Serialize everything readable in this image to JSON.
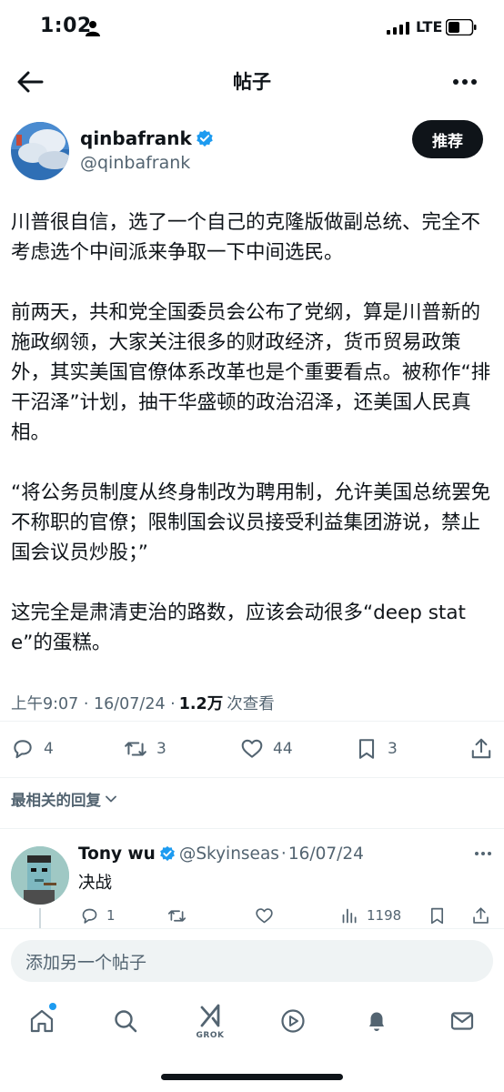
{
  "status_bar": {
    "time": "1:02",
    "network": "LTE"
  },
  "header": {
    "title": "帖子"
  },
  "post": {
    "author_name": "qinbafrank",
    "author_handle": "@qinbafrank",
    "follow_label": "推荐",
    "paragraphs": [
      "川普很自信，选了一个自己的克隆版做副总统、完全不考虑选个中间派来争取一下中间选民。",
      "前两天，共和党全国委员会公布了党纲，算是川普新的施政纲领，大家关注很多的财政经济，货币贸易政策外，其实美国官僚体系改革也是个重要看点。被称作“排干沼泽”计划，抽干华盛顿的政治沼泽，还美国人民真相。",
      "“将公务员制度从终身制改为聘用制，允许美国总统罢免不称职的官僚；限制国会议员接受利益集团游说，禁止国会议员炒股；”",
      "这完全是肃清吏治的路数，应该会动很多“deep state”的蛋糕。"
    ],
    "timestamp": "上午9:07 · 16/07/24 ·",
    "views_count": "1.2万",
    "views_label": "次查看",
    "replies": "4",
    "reposts": "3",
    "likes": "44",
    "bookmarks": "3"
  },
  "replies_section": {
    "sort_label": "最相关的回复"
  },
  "reply": {
    "name": "Tony wu",
    "handle": "@Skyinseas",
    "separator": "·",
    "date": "16/07/24",
    "text": "决战",
    "replies": "1",
    "views": "1198"
  },
  "compose": {
    "placeholder": "添加另一个帖子"
  },
  "bottom_nav": {
    "grok_label": "GROK"
  },
  "colors": {
    "text": "#0f1419",
    "secondary": "#536471",
    "verified": "#1d9bf0",
    "button_bg": "#0f1419"
  },
  "icons": [
    "person-icon",
    "signal-icon",
    "battery-icon",
    "back-arrow-icon",
    "more-icon",
    "verified-icon",
    "reply-icon",
    "repost-icon",
    "like-icon",
    "bookmark-icon",
    "share-icon",
    "views-icon",
    "chevron-down-icon",
    "home-icon",
    "search-icon",
    "grok-icon",
    "video-icon",
    "notifications-icon",
    "messages-icon"
  ]
}
